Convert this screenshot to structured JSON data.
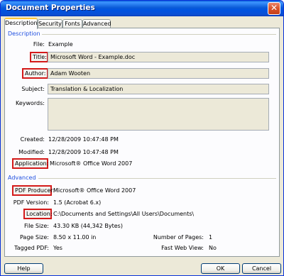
{
  "window": {
    "title": "Document Properties",
    "close": "✕"
  },
  "tabs": [
    "Description",
    "Security",
    "Fonts",
    "Advanced"
  ],
  "description": {
    "heading": "Description",
    "file_label": "File:",
    "file_value": "Example",
    "title_label": "Title:",
    "title_value": "Microsoft Word - Example.doc",
    "author_label": "Author:",
    "author_value": "Adam Wooten",
    "subject_label": "Subject:",
    "subject_value": "Translation & Localization",
    "keywords_label": "Keywords:",
    "keywords_value": "",
    "created_label": "Created:",
    "created_value": "12/28/2009 10:47:48 PM",
    "modified_label": "Modified:",
    "modified_value": "12/28/2009 10:47:48 PM",
    "application_label": "Application:",
    "application_value": "Microsoft® Office Word 2007"
  },
  "advanced": {
    "heading": "Advanced",
    "producer_label": "PDF Producer:",
    "producer_value": "Microsoft® Office Word 2007",
    "version_label": "PDF Version:",
    "version_value": "1.5 (Acrobat 6.x)",
    "location_label": "Location:",
    "location_value": "C:\\Documents and Settings\\All Users\\Documents\\",
    "filesize_label": "File Size:",
    "filesize_value": "43.30 KB (44,342 Bytes)",
    "pagesize_label": "Page Size:",
    "pagesize_value": "8.50 x 11.00 in",
    "numpages_label": "Number of Pages:",
    "numpages_value": "1",
    "tagged_label": "Tagged PDF:",
    "tagged_value": "Yes",
    "fastweb_label": "Fast Web View:",
    "fastweb_value": "No"
  },
  "buttons": {
    "help": "Help",
    "ok": "OK",
    "cancel": "Cancel"
  },
  "highlighted_fields": [
    "Title:",
    "Author:",
    "Application:",
    "PDF Producer:",
    "Location:"
  ],
  "colors": {
    "highlight_border": "#d41a1a",
    "titlebar": "#0a5ad7",
    "section_heading": "#1f4fe0"
  }
}
